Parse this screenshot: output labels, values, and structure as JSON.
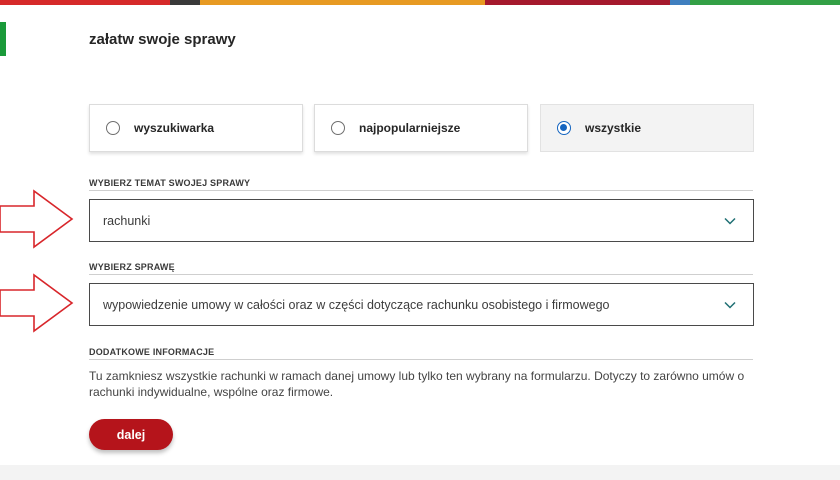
{
  "colors": {
    "accent_green": "#1a9a3a",
    "selected_blue": "#1565c0",
    "button_red": "#b5141b",
    "arrow_red": "#d8262b",
    "strip": [
      "#d62a2a",
      "#3a3a3a",
      "#e79a22",
      "#a5192d",
      "#3f7fbf",
      "#33a046"
    ]
  },
  "page": {
    "title": "załatw swoje sprawy"
  },
  "filter_tabs": [
    {
      "label": "wyszukiwarka",
      "selected": false
    },
    {
      "label": "najpopularniejsze",
      "selected": false
    },
    {
      "label": "wszystkie",
      "selected": true
    }
  ],
  "topic": {
    "label": "WYBIERZ TEMAT SWOJEJ SPRAWY",
    "value": "rachunki",
    "icon": "chevron-down-icon"
  },
  "matter": {
    "label": "WYBIERZ SPRAWĘ",
    "value": "wypowiedzenie umowy w całości oraz w części dotyczące rachunku osobistego i firmowego",
    "icon": "chevron-down-icon"
  },
  "additional_info": {
    "label": "DODATKOWE INFORMACJE",
    "text": "Tu zamkniesz wszystkie rachunki w ramach danej umowy lub tylko ten wybrany na formularzu. Dotyczy to zarówno umów o rachunki indywidualne, wspólne oraz firmowe."
  },
  "actions": {
    "next_label": "dalej"
  }
}
